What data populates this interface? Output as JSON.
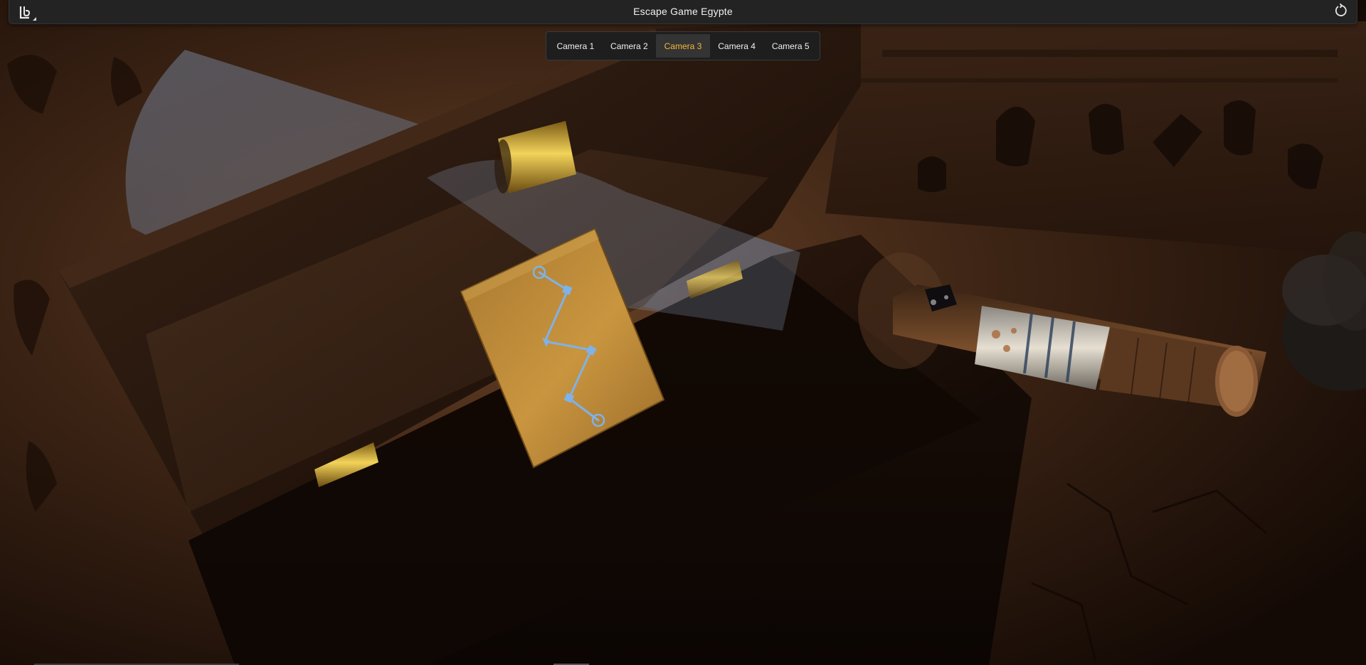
{
  "app": {
    "title": "Escape Game Egypte",
    "logo_icon": "app-logo-icon",
    "reset_icon": "rotate-ccw-icon"
  },
  "cameras": {
    "tabs": [
      {
        "label": "Camera 1",
        "active": false
      },
      {
        "label": "Camera 2",
        "active": false
      },
      {
        "label": "Camera 3",
        "active": true
      },
      {
        "label": "Camera 4",
        "active": false
      },
      {
        "label": "Camera 5",
        "active": false
      }
    ],
    "active_color": "#f0b93c"
  },
  "scene": {
    "puzzle_card_color": "#b98a3c",
    "constellation_color": "#7fb2e8",
    "hinge_color": "#c9a53a",
    "wall_color": "#3a2214",
    "chest_color": "#1a0d07"
  }
}
